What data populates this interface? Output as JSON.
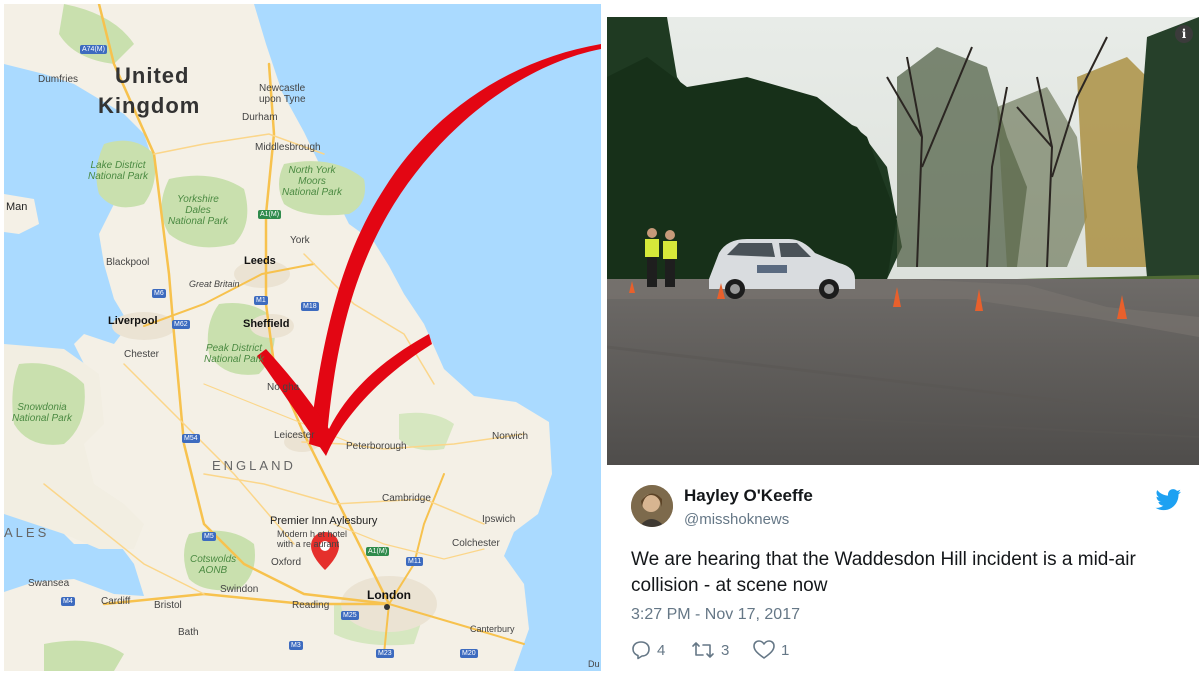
{
  "map": {
    "title": "United Kingdom",
    "title_line1": "United",
    "title_line2": "Kingdom",
    "country_label": "ENGLAND",
    "left_edge_labels": {
      "man": "Man",
      "wales": "ALES"
    },
    "parks": {
      "lake_district": [
        "Lake District",
        "National Park"
      ],
      "yorkshire_dales": [
        "Yorkshire",
        "Dales",
        "National Park"
      ],
      "north_york_moors": [
        "North York",
        "Moors",
        "National Park"
      ],
      "peak_district": [
        "Peak District",
        "National Park"
      ],
      "snowdonia": [
        "Snowdonia",
        "National Park"
      ],
      "cotswolds": [
        "Cotswolds",
        "AONB"
      ]
    },
    "places": {
      "dumfries": "Dumfries",
      "newcastle": [
        "Newcastle",
        "upon Tyne"
      ],
      "durham": "Durham",
      "middlesbrough": "Middlesbrough",
      "york": "York",
      "blackpool": "Blackpool",
      "leeds": "Leeds",
      "great_britain": "Great Britain",
      "liverpool": "Liverpool",
      "sheffield": "Sheffield",
      "chester": "Chester",
      "nottingham_partial": "No    gha",
      "leicester": "Leicester",
      "peterborough": "Peterborough",
      "norwich": "Norwich",
      "cambridge": "Cambridge",
      "premier_inn": "Premier Inn Aylesbury",
      "premier_inn_sub": [
        "Modern h    et hotel",
        "with a re   aurant"
      ],
      "ipswich": "Ipswich",
      "colchester": "Colchester",
      "oxford": "Oxford",
      "swansea": "Swansea",
      "swindon": "Swindon",
      "cardiff": "Cardiff",
      "bristol": "Bristol",
      "reading": "Reading",
      "london": "London",
      "bath": "Bath",
      "canterbury": "Canterbury",
      "du_partial": "Du"
    },
    "road_shields": {
      "a74m": "A74(M)",
      "a1m_north": "A1(M)",
      "m6": "M6",
      "m62": "M62",
      "m1": "M1",
      "m18": "M18",
      "m54": "M54",
      "m5": "M5",
      "a1m_south": "A1(M)",
      "m11": "M11",
      "m4": "M4",
      "m25": "M25",
      "m3": "M3",
      "m23": "M23",
      "m20": "M20"
    },
    "pin_icon": "map-marker-pin-icon",
    "arrow_icon": "red-hand-drawn-arrow",
    "colors": {
      "water": "#aadaff",
      "land": "#f5f1e8",
      "park": "#c8dfae",
      "pin": "#e5302c",
      "arrow": "#e30613"
    }
  },
  "tweet": {
    "author_name": "Hayley O'Keeffe",
    "author_handle": "@misshoknews",
    "text": "We are hearing that the Waddesdon Hill incident is a mid-air collision - at scene now",
    "timestamp": "3:27 PM - Nov 17, 2017",
    "replies": "4",
    "retweets": "3",
    "likes": "1",
    "info_icon": "i",
    "icons": [
      "reply-icon",
      "retweet-icon",
      "like-icon",
      "twitter-bird-icon",
      "info-icon"
    ],
    "colors": {
      "twitter_blue": "#1da1f2",
      "text": "#14171a",
      "muted": "#657786"
    }
  }
}
